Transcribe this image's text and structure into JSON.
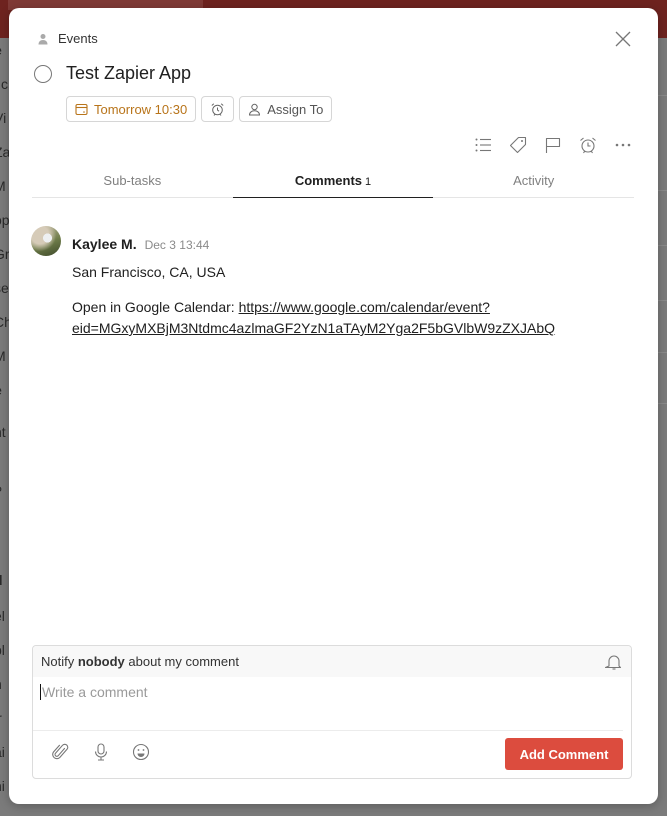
{
  "background": {
    "left_text_fragments": [
      "e",
      "Jc",
      "Vi",
      "Za",
      "M",
      "op",
      "Gr",
      "se",
      "Ch",
      "M",
      "e",
      "nt",
      "P",
      "d",
      "el",
      "bl",
      "h",
      "ir",
      "ai",
      "ni",
      "us"
    ],
    "topbar_color": "#6e231f"
  },
  "modal": {
    "project": {
      "icon": "person-icon",
      "label": "Events"
    },
    "close_icon": "close-icon",
    "task": {
      "title": "Test Zapier App",
      "completed": false
    },
    "chips": {
      "due": {
        "icon": "calendar-icon",
        "label": "Tomorrow 10:30",
        "color": "#b8741a"
      },
      "reminder": {
        "icon": "alarm-clock-icon"
      },
      "assign": {
        "icon": "person-outline-icon",
        "label": "Assign To"
      }
    },
    "actions": [
      "list-icon",
      "label-tag-icon",
      "flag-icon",
      "alarm-clock-icon",
      "more-icon"
    ],
    "tabs": [
      {
        "label": "Sub-tasks",
        "count": "",
        "active": false
      },
      {
        "label": "Comments",
        "count": "1",
        "active": true
      },
      {
        "label": "Activity",
        "count": "",
        "active": false
      }
    ],
    "comments": [
      {
        "author": "Kaylee M.",
        "time": "Dec 3 13:44",
        "line1": "San Francisco, CA, USA",
        "line2_prefix": "Open in Google Calendar: ",
        "link": "https://www.google.com/calendar/event?eid=MGxyMXBjM3Ntdmc4azlmaGF2YzN1aTAyM2Yga2F5bGVlbW9zZXJAbQ",
        "link_line1": "https://www.google.com/calendar/event?",
        "link_line2": "eid=MGxyMXBjM3Ntdmc4azlmaGF2YzN1aTAyM2Yga2F5bGVlbW9zZXJAbQ"
      }
    ],
    "composer": {
      "notify_prefix": "Notify ",
      "notify_who": "nobody",
      "notify_suffix": " about my comment",
      "placeholder": "Write a comment",
      "value": "",
      "tools": [
        "paperclip-icon",
        "microphone-icon",
        "emoji-icon"
      ],
      "submit_label": "Add Comment",
      "submit_color": "#dc4c3e"
    }
  }
}
